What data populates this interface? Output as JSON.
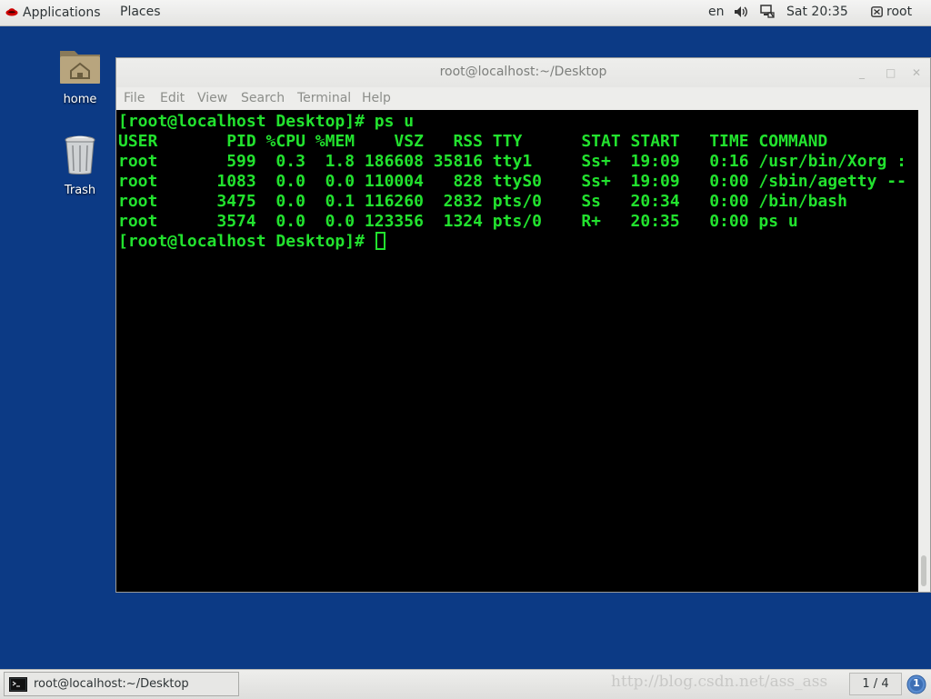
{
  "top_panel": {
    "applications": "Applications",
    "places": "Places",
    "language": "en",
    "clock": "Sat 20:35",
    "user": "root"
  },
  "desktop": {
    "icons": [
      {
        "label": "home",
        "icon": "home-folder-icon"
      },
      {
        "label": "Trash",
        "icon": "trash-icon"
      }
    ]
  },
  "window": {
    "title": "root@localhost:~/Desktop",
    "controls": {
      "minimize": "_",
      "maximize": "□",
      "close": "✕"
    },
    "menu": [
      "File",
      "Edit",
      "View",
      "Search",
      "Terminal",
      "Help"
    ]
  },
  "terminal": {
    "lines": [
      "[root@localhost Desktop]# ps u",
      "USER       PID %CPU %MEM    VSZ   RSS TTY      STAT START   TIME COMMAND",
      "root       599  0.3  1.8 186608 35816 tty1     Ss+  19:09   0:16 /usr/bin/Xorg :",
      "root      1083  0.0  0.0 110004   828 ttyS0    Ss+  19:09   0:00 /sbin/agetty --",
      "root      3475  0.0  0.1 116260  2832 pts/0    Ss   20:34   0:00 /bin/bash",
      "root      3574  0.0  0.0 123356  1324 pts/0    R+   20:35   0:00 ps u"
    ],
    "prompt": "[root@localhost Desktop]# ",
    "text_color": "#22e22e"
  },
  "taskbar": {
    "task_label": "root@localhost:~/Desktop",
    "workspace": "1 / 4",
    "watermark": "http://blog.csdn.net/ass_ass",
    "notification_count": "1"
  },
  "colors": {
    "desktop_bg": "#0c3a85",
    "terminal_bg": "#000000"
  }
}
